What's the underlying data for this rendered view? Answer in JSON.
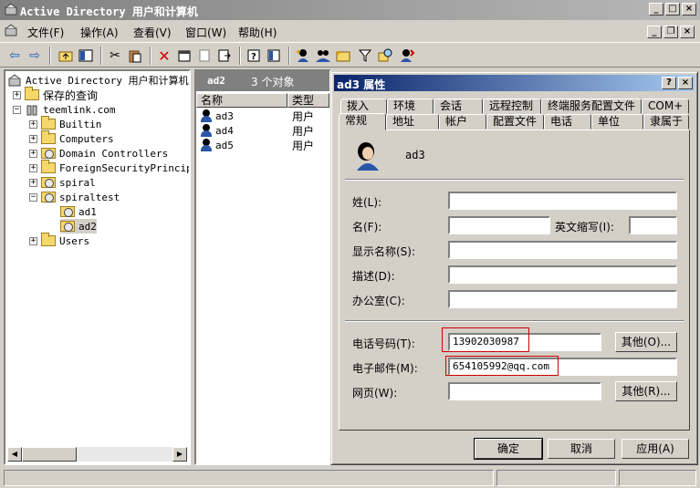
{
  "window": {
    "title": "Active Directory 用户和计算机"
  },
  "menu": [
    "文件(F)",
    "操作(A)",
    "查看(V)",
    "窗口(W)",
    "帮助(H)"
  ],
  "toolbar_icons": [
    "back-icon",
    "forward-icon",
    "up-icon",
    "show-tree-icon",
    "cut-icon",
    "paste-icon",
    "delete-icon",
    "properties-icon",
    "copy-icon",
    "export-icon",
    "help-icon",
    "console-icon",
    "new-user-icon",
    "new-group-icon",
    "new-ou-icon",
    "filter-icon",
    "find-icon",
    "add-to-group-icon"
  ],
  "tree": {
    "root": "Active Directory 用户和计算机",
    "saved_queries": "保存的查询",
    "domain": "teemlink.com",
    "items": [
      "Builtin",
      "Computers",
      "Domain Controllers",
      "ForeignSecurityPrincipa",
      "spiral",
      "spiraltest"
    ],
    "children": [
      "ad1",
      "ad2"
    ],
    "last": "Users"
  },
  "list": {
    "header_name": "ad2",
    "header_count": "3 个对象",
    "col_name": "名称",
    "col_type": "类型",
    "rows": [
      {
        "name": "ad3",
        "type": "用户"
      },
      {
        "name": "ad4",
        "type": "用户"
      },
      {
        "name": "ad5",
        "type": "用户"
      }
    ]
  },
  "dialog": {
    "title": "ad3 属性",
    "help_btn": "?",
    "close_btn": "×",
    "tabs_row1": [
      "拨入",
      "环境",
      "会话",
      "远程控制",
      "终端服务配置文件",
      "COM+"
    ],
    "tabs_row2": [
      "常规",
      "地址",
      "帐户",
      "配置文件",
      "电话",
      "单位",
      "隶属于"
    ],
    "user_name": "ad3",
    "labels": {
      "surname": "姓(L):",
      "given": "名(F):",
      "initials": "英文缩写(I):",
      "display": "显示名称(S):",
      "description": "描述(D):",
      "office": "办公室(C):",
      "phone": "电话号码(T):",
      "email": "电子邮件(M):",
      "web": "网页(W):"
    },
    "values": {
      "surname": "",
      "given": "",
      "initials": "",
      "display": "",
      "description": "",
      "office": "",
      "phone": "13902030987",
      "email": "654105992@qq.com",
      "web": ""
    },
    "other_phone": "其他(O)...",
    "other_web": "其他(R)...",
    "ok": "确定",
    "cancel": "取消",
    "apply": "应用(A)"
  },
  "colors": {
    "highlight_box": "#d00000",
    "dialog_title": "#0a246a"
  }
}
